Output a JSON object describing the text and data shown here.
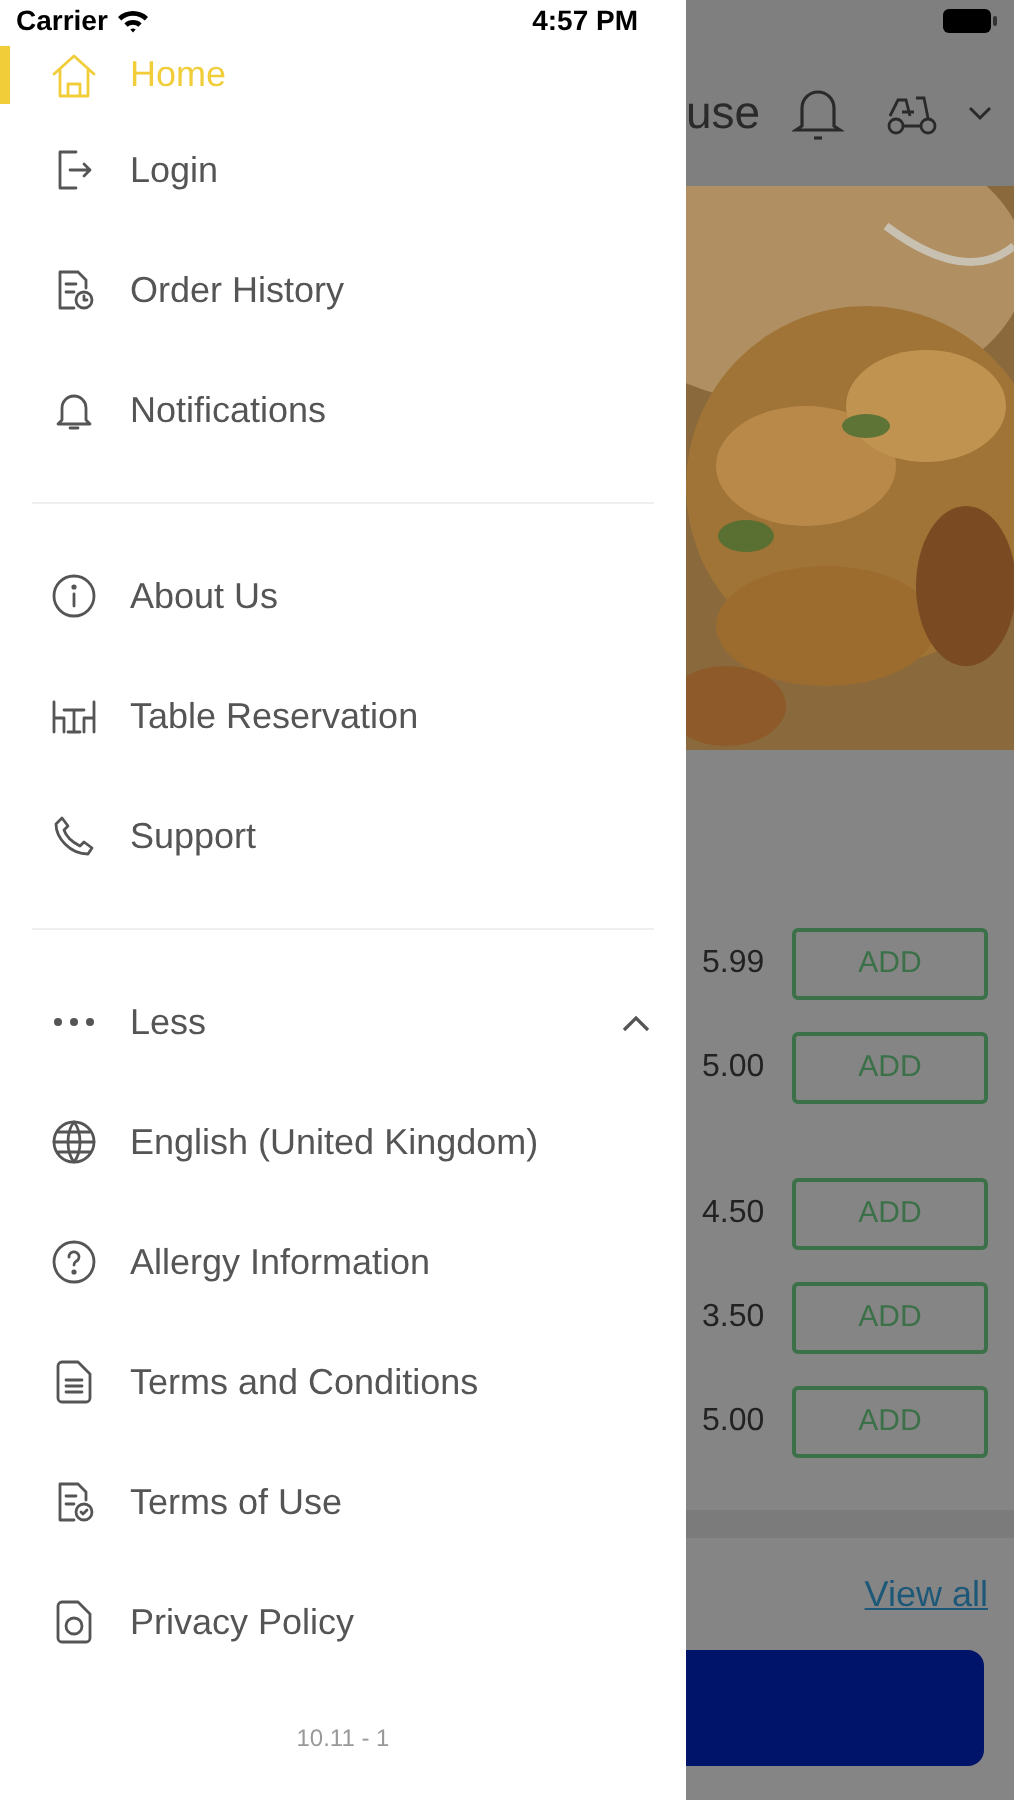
{
  "status_bar": {
    "carrier": "Carrier",
    "time": "4:57 PM"
  },
  "drawer": {
    "sections": [
      {
        "items": [
          {
            "label": "Home",
            "selected": true
          },
          {
            "label": "Login",
            "selected": false
          },
          {
            "label": "Order History",
            "selected": false
          },
          {
            "label": "Notifications",
            "selected": false
          }
        ]
      },
      {
        "items": [
          {
            "label": "About Us",
            "selected": false
          },
          {
            "label": "Table Reservation",
            "selected": false
          },
          {
            "label": "Support",
            "selected": false
          }
        ]
      }
    ],
    "more": {
      "label": "Less",
      "expanded": true,
      "items": [
        {
          "label": "English (United Kingdom)",
          "selected": false
        },
        {
          "label": "Allergy Information",
          "selected": false
        },
        {
          "label": "Terms and Conditions",
          "selected": false
        },
        {
          "label": "Terms of Use",
          "selected": false
        },
        {
          "label": "Privacy Policy",
          "selected": false
        }
      ]
    },
    "version": "10.11 - 1"
  },
  "background_page": {
    "title": "use",
    "groups": [
      {
        "items": [
          {
            "price": "5.99",
            "button": "ADD"
          },
          {
            "price": "5.00",
            "button": "ADD"
          }
        ]
      },
      {
        "items": [
          {
            "price": "4.50",
            "button": "ADD"
          },
          {
            "price": "3.50",
            "button": "ADD"
          },
          {
            "price": "5.00",
            "button": "ADD"
          }
        ]
      }
    ],
    "view_all": "View all"
  }
}
